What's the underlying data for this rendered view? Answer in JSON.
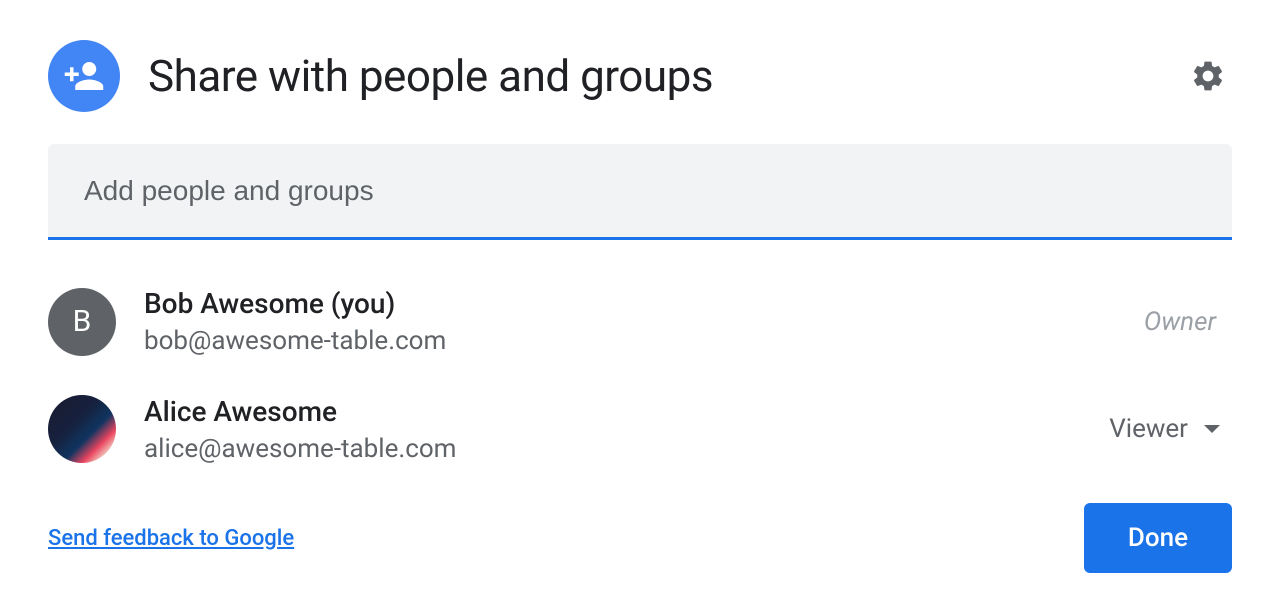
{
  "header": {
    "title": "Share with people and groups"
  },
  "input": {
    "placeholder": "Add people and groups"
  },
  "people": [
    {
      "name": "Bob Awesome (you)",
      "email": "bob@awesome-table.com",
      "avatar_letter": "B",
      "role": "Owner",
      "role_type": "owner"
    },
    {
      "name": "Alice Awesome",
      "email": "alice@awesome-table.com",
      "role": "Viewer",
      "role_type": "dropdown"
    }
  ],
  "footer": {
    "feedback_link": "Send feedback to Google",
    "done_button": "Done"
  }
}
